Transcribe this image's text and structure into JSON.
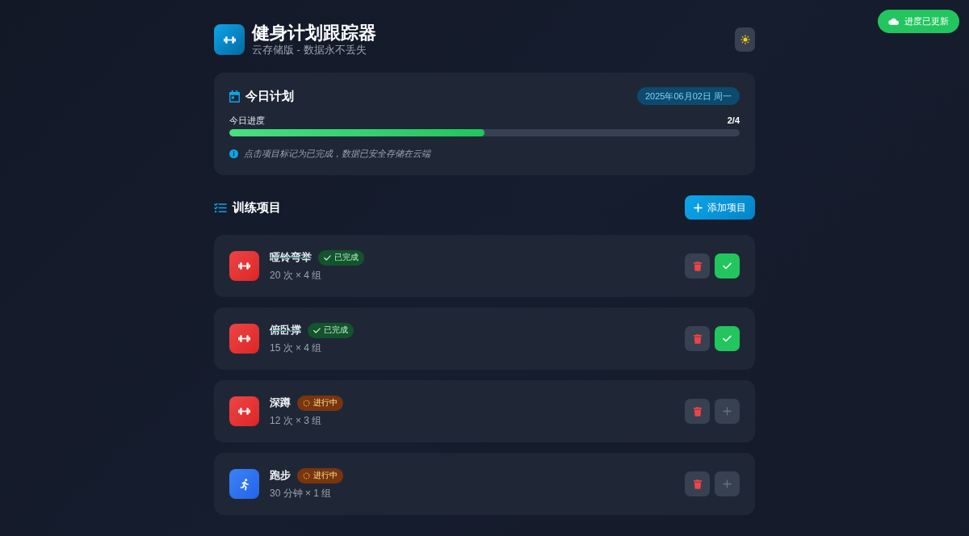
{
  "toast": {
    "text": "进度已更新"
  },
  "header": {
    "title": "健身计划跟踪器",
    "subtitle": "云存储版 - 数据永不丢失"
  },
  "today": {
    "title": "今日计划",
    "date": "2025年06月02日 周一",
    "progress_label": "今日进度",
    "progress_count": "2/4",
    "level": 0.5,
    "note": "点击项目标记为已完成，数据已安全存储在云端"
  },
  "exercises_section": {
    "title": "训练项目",
    "add_button": "添加项目"
  },
  "exercises": [
    {
      "kind": "strength",
      "name": "哑铃弯举",
      "done": true,
      "status": "已完成",
      "detail": "20 次 × 4 组"
    },
    {
      "kind": "strength",
      "name": "俯卧撑",
      "done": true,
      "status": "已完成",
      "detail": "15 次 × 4 组"
    },
    {
      "kind": "strength",
      "name": "深蹲",
      "done": false,
      "status": "进行中",
      "detail": "12 次 × 3 组"
    },
    {
      "kind": "cardio",
      "name": "跑步",
      "done": false,
      "status": "进行中",
      "detail": "30 分钟 × 1 组"
    }
  ]
}
